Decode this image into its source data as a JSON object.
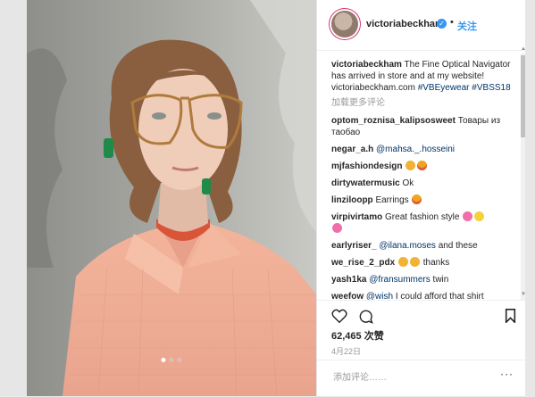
{
  "header": {
    "username": "victoriabeckham",
    "separator": "•",
    "follow_label": "关注"
  },
  "caption": {
    "username": "victoriabeckham",
    "text": "The Fine Optical Navigator has arrived in store and at my website! victoriabeckham.com",
    "hashtags": "#VBEyewear #VBSS18"
  },
  "load_more": "加载更多评论",
  "comments": [
    {
      "user": "optom_roznisa_kalipsosweet",
      "text": "Товары из таобао"
    },
    {
      "user": "negar_a.h",
      "mention": "@mahsa._.hosseini",
      "text": ""
    },
    {
      "user": "mjfashiondesign",
      "text": "",
      "emoji": [
        "face",
        "face2"
      ]
    },
    {
      "user": "dirtywatermusic",
      "text": "Ok"
    },
    {
      "user": "linziloopp",
      "text": "Earrings",
      "emoji": [
        "face2"
      ]
    },
    {
      "user": "virpivirtamo",
      "text": "Great fashion style",
      "emoji": [
        "flower",
        "sun",
        "flower"
      ]
    },
    {
      "user": "earlyriser_",
      "mention": "@ilana.moses",
      "text": "and these"
    },
    {
      "user": "we_rise_2_pdx",
      "text": "thanks",
      "emoji": [
        "face",
        "face"
      ]
    },
    {
      "user": "yash1ka",
      "mention": "@fransummers",
      "text": "twin"
    },
    {
      "user": "weefow",
      "mention": "@wish",
      "text": "I could afford that shirt"
    }
  ],
  "likes": "62,465 次赞",
  "date": "4月22日",
  "add_comment_placeholder": "添加评论……",
  "more_label": "···",
  "colors": {
    "accent": "#3897f0",
    "hashtag": "#003569",
    "muted": "#999999"
  }
}
